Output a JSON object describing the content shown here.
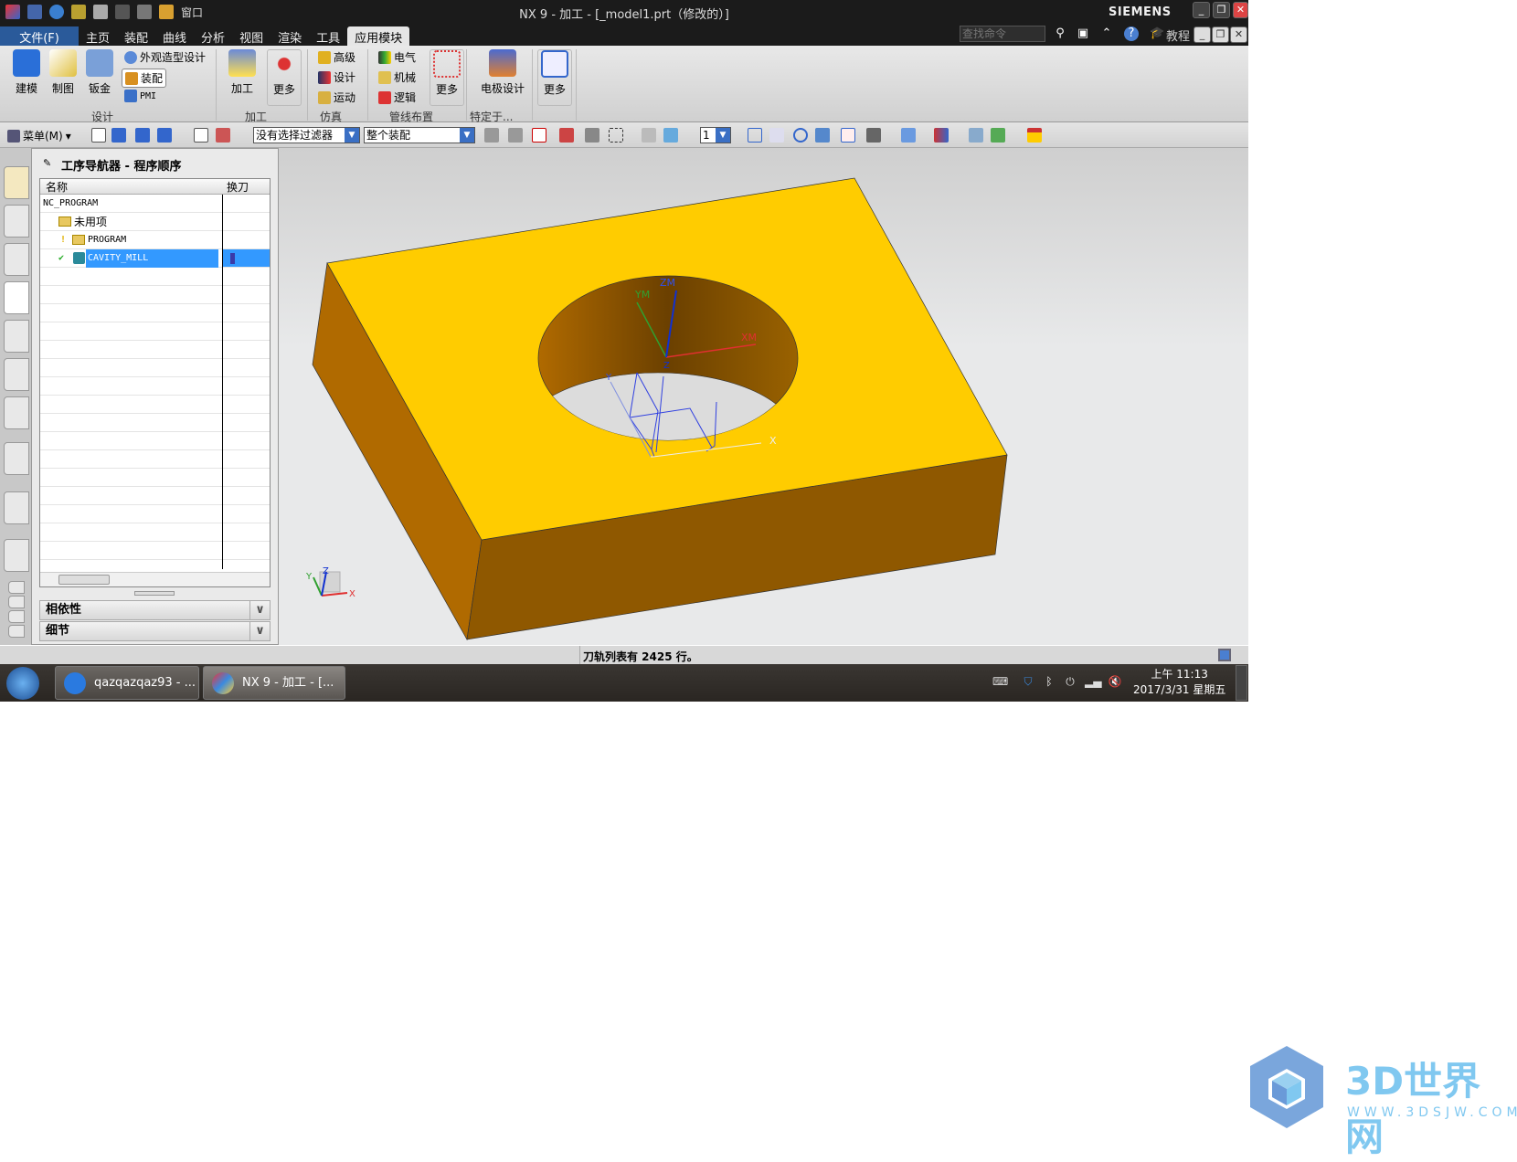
{
  "window": {
    "title": "NX 9 - 加工 - [_model1.prt（修改的）]",
    "brand": "SIEMENS",
    "quick_access": {
      "window_menu": "窗口"
    }
  },
  "menu_tabs": [
    "文件(F)",
    "主页",
    "装配",
    "曲线",
    "分析",
    "视图",
    "渲染",
    "工具",
    "应用模块"
  ],
  "active_tab": "应用模块",
  "command_search": {
    "placeholder": "查找命令"
  },
  "tutorial_label": "教程",
  "ribbon": {
    "design": {
      "label": "设计",
      "items": {
        "modeling": "建模",
        "drafting": "制图",
        "sheetmetal": "钣金",
        "shape_studio": "外观造型设计",
        "assembly": "装配",
        "pmi": "PMI"
      }
    },
    "manufacturing": {
      "label": "加工",
      "items": {
        "machining": "加工",
        "more": "更多"
      }
    },
    "simulation": {
      "label": "仿真",
      "items": {
        "advanced": "高级",
        "design": "设计",
        "motion": "运动"
      }
    },
    "routing": {
      "label": "管线布置",
      "items": {
        "electrical": "电气",
        "mechanical": "机械",
        "logical": "逻辑",
        "more": "更多"
      }
    },
    "specific": {
      "label": "特定于...",
      "items": {
        "electrode": "电极设计"
      }
    },
    "more": {
      "label": "更多"
    }
  },
  "toolbar": {
    "menu_label": "菜单(M)",
    "selection_filter": "没有选择过滤器",
    "scope": "整个装配",
    "layer": "1"
  },
  "navigator": {
    "title": "工序导航器 - 程序顺序",
    "columns": [
      "名称",
      "换刀"
    ],
    "rows": [
      {
        "name": "NC_PROGRAM",
        "level": 0
      },
      {
        "name": "未用项",
        "level": 1
      },
      {
        "name": "PROGRAM",
        "level": 1
      },
      {
        "name": "CAVITY_MILL",
        "level": 1,
        "selected": true,
        "status": "complete"
      }
    ],
    "sections": [
      "相依性",
      "细节"
    ]
  },
  "viewport": {
    "wcs_labels": {
      "xm": "XM",
      "ym": "YM",
      "zm": "ZM",
      "x": "X",
      "y": "Y",
      "z": "Z"
    },
    "triad_labels": {
      "x": "X",
      "y": "Y",
      "z": "Z"
    },
    "colors": {
      "top": "#ffcc00",
      "front": "#8f5800",
      "side": "#b06a00",
      "background": "#e8e9ea"
    }
  },
  "status": {
    "message": "刀轨列表有 2425 行。"
  },
  "taskbar": {
    "tasks": [
      "qazqazqaz93 - ...",
      "NX 9 - 加工 - [..."
    ],
    "time": "上午 11:13",
    "date": "2017/3/31 星期五"
  },
  "watermark": {
    "brand": "3D世界网",
    "url": "WWW.3DSJW.COM"
  }
}
